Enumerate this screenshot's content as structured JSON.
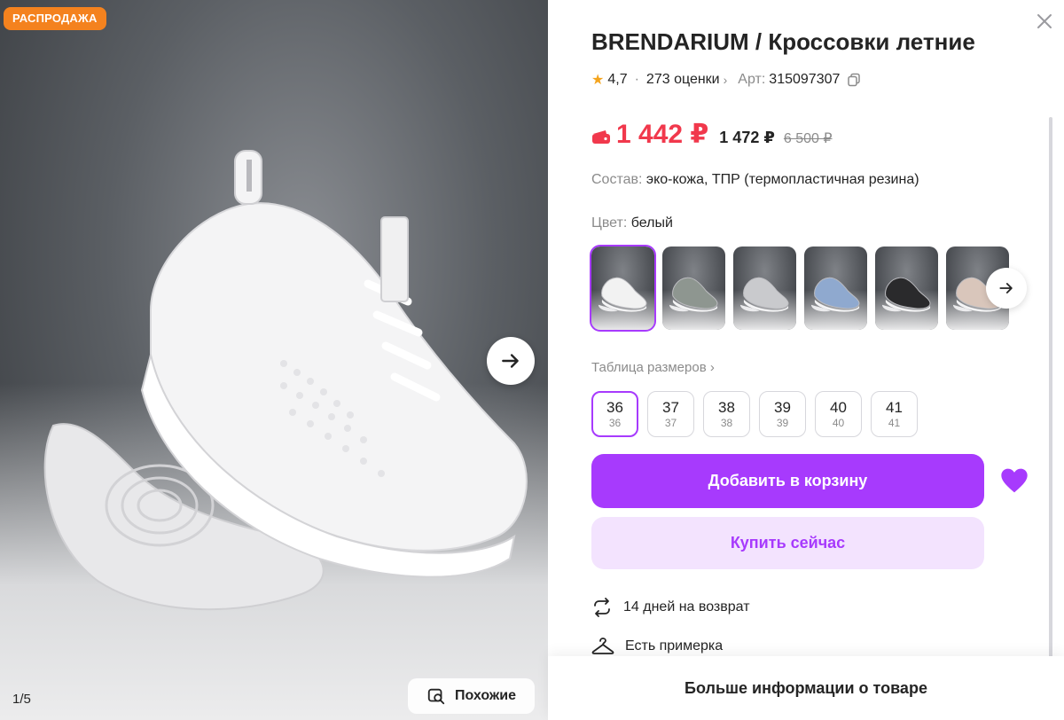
{
  "gallery": {
    "sale_badge": "РАСПРОДАЖА",
    "counter": "1/5",
    "similar_label": "Похожие"
  },
  "product": {
    "title": "BRENDARIUM / Кроссовки летние",
    "rating": "4,7",
    "reviews": "273 оценки",
    "article_label": "Арт:",
    "article": "315097307",
    "price_main": "1 442 ₽",
    "price_second": "1 472 ₽",
    "price_old": "6 500 ₽",
    "composition_label": "Состав:",
    "composition": "эко-кожа, ТПР (термопластичная резина)",
    "color_label": "Цвет:",
    "color": "белый",
    "swatches": [
      {
        "name": "white",
        "shoe": "#f2f2f2"
      },
      {
        "name": "gray-green",
        "shoe": "#8e9690"
      },
      {
        "name": "light-gray",
        "shoe": "#c9cacd"
      },
      {
        "name": "blue",
        "shoe": "#8fa9cf"
      },
      {
        "name": "black",
        "shoe": "#2a2a2c"
      },
      {
        "name": "beige",
        "shoe": "#d9c6bb"
      }
    ],
    "size_table_label": "Таблица размеров",
    "sizes": [
      {
        "eu": "36",
        "ru": "36"
      },
      {
        "eu": "37",
        "ru": "37"
      },
      {
        "eu": "38",
        "ru": "38"
      },
      {
        "eu": "39",
        "ru": "39"
      },
      {
        "eu": "40",
        "ru": "40"
      },
      {
        "eu": "41",
        "ru": "41"
      }
    ],
    "add_to_cart": "Добавить в корзину",
    "buy_now": "Купить сейчас",
    "return_info": "14 дней на возврат",
    "fitting_info": "Есть примерка",
    "more_info": "Больше информации о товаре"
  },
  "colors": {
    "accent": "#a73afd",
    "accent_light": "#f3e3fe",
    "price_red": "#f1384c",
    "sale_orange": "#f4821e",
    "star": "#f4a41d"
  },
  "icons": [
    "arrow-right-icon",
    "search-similar-icon",
    "close-icon",
    "star-icon",
    "copy-icon",
    "wallet-icon",
    "heart-icon",
    "return-icon",
    "hanger-icon"
  ]
}
